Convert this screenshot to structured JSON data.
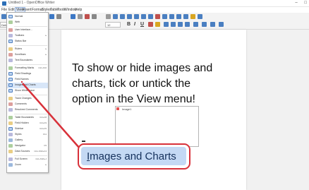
{
  "window": {
    "title": "Untitled 1 - OpenOffice Writer",
    "controls": [
      "–",
      "□"
    ]
  },
  "menubar": {
    "items": [
      {
        "label": "File",
        "active": false
      },
      {
        "label": "Edit",
        "active": false
      },
      {
        "label": "View",
        "active": true
      },
      {
        "label": "Insert",
        "active": false
      },
      {
        "label": "Format",
        "active": false
      },
      {
        "label": "Styles",
        "active": false
      },
      {
        "label": "Table",
        "active": false
      },
      {
        "label": "Tools",
        "active": false
      },
      {
        "label": "Window",
        "active": false
      },
      {
        "label": "Help",
        "active": false
      }
    ]
  },
  "toolbar": {
    "paragraph_style": "Default Para",
    "font_size": "12",
    "bold": "B",
    "italic": "I",
    "underline": "U"
  },
  "view_menu": {
    "items": [
      {
        "label": "Normal",
        "accel": "",
        "checked": true
      },
      {
        "label": "Web",
        "accel": "",
        "checked": false
      },
      {
        "sep": true
      },
      {
        "label": "User Interface...",
        "accel": "",
        "checked": false
      },
      {
        "label": "Toolbars",
        "accel": "▸",
        "checked": false
      },
      {
        "label": "Status Bar",
        "accel": "",
        "checked": true
      },
      {
        "sep": true
      },
      {
        "label": "Rulers",
        "accel": "▸",
        "checked": false
      },
      {
        "label": "Scrollbars",
        "accel": "▸",
        "checked": false
      },
      {
        "label": "Text Boundaries",
        "accel": "",
        "checked": false
      },
      {
        "sep": true
      },
      {
        "label": "Formatting Marks",
        "accel": "Ctrl+F10",
        "checked": false
      },
      {
        "label": "Field Shadings",
        "accel": "",
        "checked": true
      },
      {
        "label": "Field Names",
        "accel": "",
        "checked": true
      },
      {
        "label": "Images and Charts",
        "accel": "",
        "checked": true,
        "highlight": true
      },
      {
        "label": "Show Whitespace",
        "accel": "",
        "checked": true
      },
      {
        "sep": true
      },
      {
        "label": "Track Changes",
        "accel": "",
        "checked": false
      },
      {
        "label": "Comments",
        "accel": "",
        "checked": false
      },
      {
        "label": "Resolved Comments",
        "accel": "",
        "checked": false
      },
      {
        "sep": true
      },
      {
        "label": "Table Boundaries",
        "accel": "Ctrl+F8",
        "checked": false
      },
      {
        "label": "Field Hidden",
        "accel": "Ctrl+F9",
        "checked": false
      },
      {
        "label": "Sidebar",
        "accel": "Ctrl+F5",
        "checked": true
      },
      {
        "label": "Styles",
        "accel": "F11",
        "checked": false
      },
      {
        "label": "Gallery",
        "accel": "",
        "checked": false
      },
      {
        "label": "Navigator",
        "accel": "F5",
        "checked": false
      },
      {
        "label": "Data Sources",
        "accel": "Ctrl+Shift+F4",
        "checked": false
      },
      {
        "sep": true
      },
      {
        "label": "Full Screen",
        "accel": "Ctrl+Shift+J",
        "checked": false
      },
      {
        "label": "Zoom",
        "accel": "▸",
        "checked": false
      }
    ]
  },
  "caption": {
    "lines": [
      "To show or hide images and",
      "charts, tick or untick the",
      "option in the View menu!"
    ]
  },
  "image_frame": {
    "label": "Image1"
  },
  "zoom_callout": {
    "accent_letter": "I",
    "rest": "mages and Charts"
  },
  "colors": {
    "callout_red": "#d8313a",
    "highlight_blue": "#c4d9f4",
    "text_dark_blue": "#15315c"
  }
}
